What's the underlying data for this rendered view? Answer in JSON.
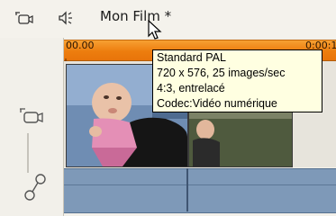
{
  "header": {
    "title": "Mon Film *",
    "icons": [
      "camera-track-icon",
      "audio-track-icon"
    ]
  },
  "timeline": {
    "ruler_start": "00.00",
    "ruler_end": "0:00:1"
  },
  "tooltip": {
    "lines": [
      "Standard PAL",
      "720 x 576, 25 images/sec",
      "4:3, entrelacé",
      "Codec:Vidéo numérique"
    ]
  },
  "tracks": {
    "video_icon": "camera-icon",
    "audio_icon": "audio-link-icon"
  },
  "colors": {
    "ruler": "#ed7d0e",
    "audio_track": "#7e99b8",
    "tooltip_bg": "#ffffe1"
  }
}
